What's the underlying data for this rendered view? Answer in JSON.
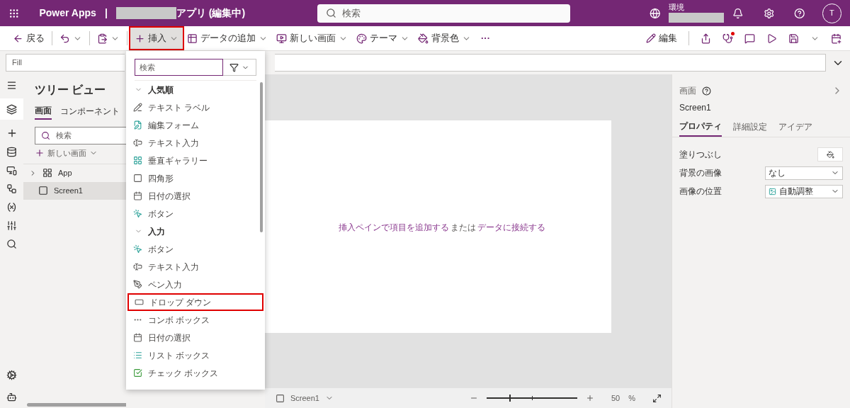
{
  "header": {
    "product": "Power Apps",
    "separator": "|",
    "app_title": "アプリ (編集中)",
    "search_placeholder": "検索",
    "environment_label": "環境",
    "avatar": "T"
  },
  "toolbar": [
    {
      "kind": "back",
      "label": "戻る",
      "highlighted": false
    },
    {
      "kind": "undo",
      "highlighted": false
    },
    {
      "kind": "paste",
      "highlighted": false
    },
    {
      "kind": "insert",
      "label": "挿入",
      "highlighted": true
    },
    {
      "kind": "data",
      "label": "データの追加",
      "highlighted": false
    },
    {
      "kind": "screen",
      "label": "新しい画面",
      "highlighted": false
    },
    {
      "kind": "theme",
      "label": "テーマ",
      "highlighted": false
    },
    {
      "kind": "background",
      "label": "背景色",
      "highlighted": false
    }
  ],
  "toolbar_more": "···",
  "toolbar_right": {
    "edit": "編集",
    "checker_alert": true
  },
  "formula_bar": {
    "property": "Fill"
  },
  "tree_view": {
    "title": "ツリー ビュー",
    "tabs": [
      {
        "label": "画面",
        "selected": true
      },
      {
        "label": "コンポーネント",
        "selected": false
      }
    ],
    "search_placeholder": "検索",
    "new_screen": "新しい画面",
    "nodes": [
      {
        "kind": "app",
        "label": "App",
        "selected": false
      },
      {
        "kind": "screen",
        "label": "Screen1",
        "selected": true
      }
    ]
  },
  "insert_pane": {
    "search_placeholder": "検索",
    "sections": [
      {
        "title": "人気順",
        "expanded": true,
        "items": [
          {
            "kind": "label",
            "label": "テキスト ラベル",
            "highlighted": false
          },
          {
            "kind": "form",
            "label": "編集フォーム",
            "highlighted": false
          },
          {
            "kind": "textinput",
            "label": "テキスト入力",
            "highlighted": false
          },
          {
            "kind": "gallery",
            "label": "垂直ギャラリー",
            "highlighted": false
          },
          {
            "kind": "rectangle",
            "label": "四角形",
            "highlighted": false
          },
          {
            "kind": "date",
            "label": "日付の選択",
            "highlighted": false
          },
          {
            "kind": "button",
            "label": "ボタン",
            "highlighted": false
          }
        ]
      },
      {
        "title": "入力",
        "expanded": true,
        "items": [
          {
            "kind": "button",
            "label": "ボタン",
            "highlighted": false
          },
          {
            "kind": "textinput",
            "label": "テキスト入力",
            "highlighted": false
          },
          {
            "kind": "pen",
            "label": "ペン入力",
            "highlighted": false
          },
          {
            "kind": "dropdown",
            "label": "ドロップ ダウン",
            "highlighted": true
          },
          {
            "kind": "combo",
            "label": "コンボ ボックス",
            "highlighted": false
          },
          {
            "kind": "date",
            "label": "日付の選択",
            "highlighted": false
          },
          {
            "kind": "listbox",
            "label": "リスト ボックス",
            "highlighted": false
          },
          {
            "kind": "checkbox",
            "label": "チェック ボックス",
            "highlighted": false
          }
        ]
      }
    ]
  },
  "canvas": {
    "link_insert": "挿入ペインで項目を追加する",
    "middle": "または",
    "link_data": "データに接続する"
  },
  "bottom_bar": {
    "screen": "Screen1",
    "zoom": {
      "level": 0.25,
      "value": "50",
      "unit": "%"
    }
  },
  "properties": {
    "type": "画面",
    "name": "Screen1",
    "tabs": [
      {
        "label": "プロパティ",
        "selected": true
      },
      {
        "label": "詳細設定",
        "selected": false
      },
      {
        "label": "アイデア",
        "selected": false
      }
    ],
    "rows": [
      {
        "kind": "color",
        "label": "塗りつぶし"
      },
      {
        "kind": "select",
        "label": "背景の画像",
        "value": "なし"
      },
      {
        "kind": "image-select",
        "label": "画像の位置",
        "value": "自動調整"
      }
    ]
  }
}
